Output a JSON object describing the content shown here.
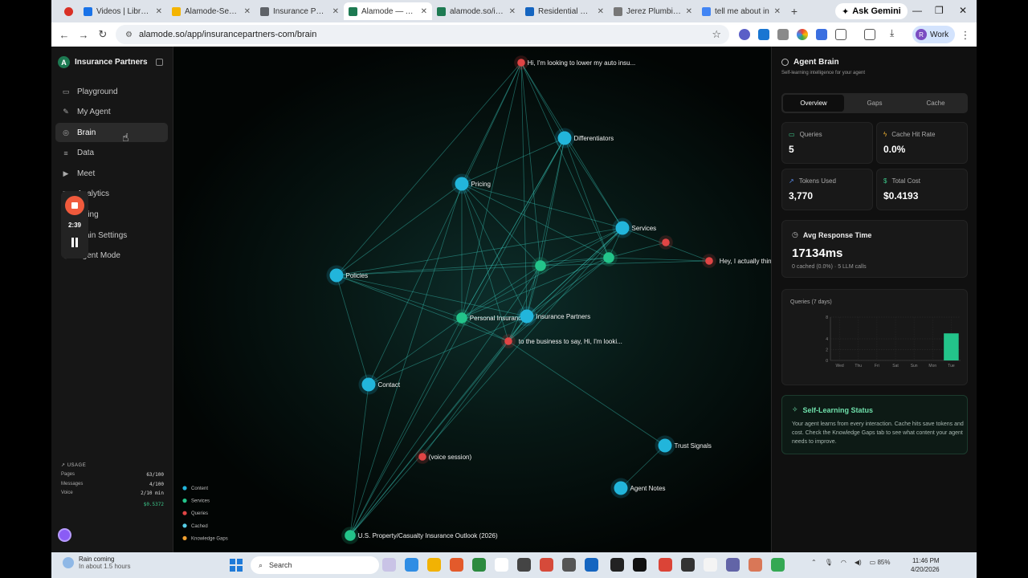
{
  "browser": {
    "tabs": [
      {
        "title": "",
        "favicon": "record-icon",
        "color": "#d93025",
        "active": false
      },
      {
        "title": "Videos | Library |",
        "favicon": "video-icon",
        "color": "#1a73e8",
        "active": false
      },
      {
        "title": "Alamode-Seed F",
        "favicon": "slides-icon",
        "color": "#f4b400",
        "active": false
      },
      {
        "title": "Insurance Partne",
        "favicon": "shield-icon",
        "color": "#5f6368",
        "active": false
      },
      {
        "title": "Alamode — AI M",
        "favicon": "alamode-icon",
        "color": "#1d7a52",
        "active": true
      },
      {
        "title": "alamode.so/insu",
        "favicon": "alamode-icon",
        "color": "#1d7a52",
        "active": false
      },
      {
        "title": "Residential Plum",
        "favicon": "drop-icon",
        "color": "#1565c0",
        "active": false
      },
      {
        "title": "Jerez Plumbing C",
        "favicon": "globe-icon",
        "color": "#777777",
        "active": false
      },
      {
        "title": "tell me about in",
        "favicon": "google-icon",
        "color": "#4285f4",
        "active": false
      }
    ],
    "new_tab": "+",
    "ask_gemini": "Ask Gemini",
    "url": "alamode.so/app/insurancepartners-com/brain",
    "profile": "Work"
  },
  "sidebar": {
    "brand": "Insurance Partners",
    "brand_initial": "A",
    "items": [
      {
        "label": "Playground",
        "icon": "chat-icon",
        "active": false
      },
      {
        "label": "My Agent",
        "icon": "edit-icon",
        "active": false
      },
      {
        "label": "Brain",
        "icon": "brain-icon",
        "active": true
      },
      {
        "label": "Data",
        "icon": "database-icon",
        "active": false
      },
      {
        "label": "Meet",
        "icon": "video-icon",
        "active": false
      },
      {
        "label": "Analytics",
        "icon": "chart-icon",
        "active": false
      },
      {
        "label": "Billing",
        "icon": "card-icon",
        "active": false
      },
      {
        "label": "Brain Settings",
        "icon": "gear-icon",
        "active": false
      },
      {
        "label": "Agent Mode",
        "icon": "bot-icon",
        "active": false
      }
    ],
    "recorder": {
      "time": "2:39"
    },
    "usage": {
      "title": "USAGE",
      "rows": [
        {
          "label": "Pages",
          "value": "63/100"
        },
        {
          "label": "Messages",
          "value": "4/100"
        },
        {
          "label": "Voice",
          "value": "2/10 min"
        }
      ],
      "cost": "$0.5372"
    }
  },
  "graph": {
    "nodes": [
      {
        "label": "Hi, I'm looking to lower my auto insu...",
        "type": "query"
      },
      {
        "label": "Differentiators",
        "type": "content"
      },
      {
        "label": "Pricing",
        "type": "content"
      },
      {
        "label": "Services",
        "type": "content"
      },
      {
        "label": "",
        "type": "query"
      },
      {
        "label": "Hey, I actually think I live by your ...",
        "type": "query"
      },
      {
        "label": "",
        "type": "service"
      },
      {
        "label": "",
        "type": "service"
      },
      {
        "label": "Policies",
        "type": "content"
      },
      {
        "label": "Personal Insurance",
        "type": "service"
      },
      {
        "label": "Insurance Partners",
        "type": "content"
      },
      {
        "label": "to the business to say, Hi, I'm looki...",
        "type": "query"
      },
      {
        "label": "Contact",
        "type": "content"
      },
      {
        "label": "Trust Signals",
        "type": "content"
      },
      {
        "label": "(voice session)",
        "type": "query"
      },
      {
        "label": "Agent Notes",
        "type": "content"
      },
      {
        "label": "U.S. Property/Casualty Insurance Outlook (2026)",
        "type": "service"
      }
    ],
    "legend": [
      {
        "label": "Content",
        "color": "#22b5db"
      },
      {
        "label": "Services",
        "color": "#23c48a"
      },
      {
        "label": "Queries",
        "color": "#e04545"
      },
      {
        "label": "Cached",
        "color": "#55cde6"
      },
      {
        "label": "Knowledge Gaps",
        "color": "#f0a030"
      }
    ],
    "colors": {
      "content": "#22b5db",
      "service": "#23c48a",
      "query": "#e04545",
      "edge": "#3fd6c8"
    }
  },
  "panel": {
    "title": "Agent Brain",
    "subtitle": "Self-learning intelligence for your agent",
    "tabs": [
      "Overview",
      "Gaps",
      "Cache"
    ],
    "active_tab": "Overview",
    "metrics": [
      {
        "label": "Queries",
        "value": "5",
        "icon": "chat-icon",
        "icon_color": "#3cc88a"
      },
      {
        "label": "Cache Hit Rate",
        "value": "0.0%",
        "icon": "bolt-icon",
        "icon_color": "#f0b030"
      },
      {
        "label": "Tokens Used",
        "value": "3,770",
        "icon": "trend-icon",
        "icon_color": "#5a8ef0"
      },
      {
        "label": "Total Cost",
        "value": "$0.4193",
        "icon": "dollar-icon",
        "icon_color": "#3cc88a"
      }
    ],
    "response": {
      "title": "Avg Response Time",
      "value": "17134ms",
      "sub": "0 cached (0.0%) · 5 LLM calls"
    },
    "self_learning": {
      "title": "Self-Learning Status",
      "body": "Your agent learns from every interaction. Cache hits save tokens and cost. Check the Knowledge Gaps tab to see what content your agent needs to improve."
    }
  },
  "chart_data": {
    "type": "bar",
    "title": "Queries (7 days)",
    "categories": [
      "Wed",
      "Thu",
      "Fri",
      "Sat",
      "Sun",
      "Mon",
      "Tue"
    ],
    "values": [
      0,
      0,
      0,
      0,
      0,
      0,
      5
    ],
    "ylim": [
      0,
      8
    ],
    "yticks": [
      0,
      2,
      4,
      8
    ],
    "bar_color": "#23c48a",
    "grid": true
  },
  "taskbar": {
    "weather_title": "Rain coming",
    "weather_sub": "In about 1.5 hours",
    "search": "Search",
    "battery": "85%",
    "time": "11:46 PM",
    "date": "4/20/2026"
  }
}
